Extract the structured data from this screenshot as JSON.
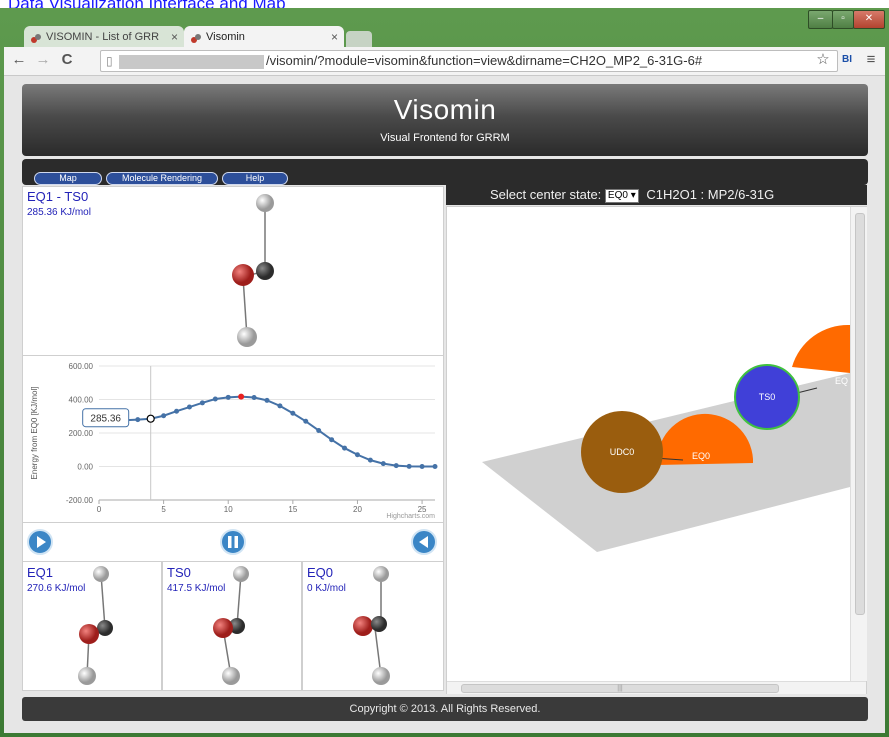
{
  "top_link": "Data Visualization Interface and Map",
  "window": {
    "tabs": [
      {
        "label": "VISOMIN - List of GRR"
      },
      {
        "label": "Visomin"
      }
    ],
    "url_prefix": "",
    "url": "/visomin/?module=visomin&function=view&dirname=CH2O_MP2_6-31G-6#",
    "bi_label": "BI"
  },
  "header": {
    "title": "Visomin",
    "subtitle": "Visual Frontend for GRRM"
  },
  "menu": [
    "Map",
    "Molecule Rendering",
    "Help"
  ],
  "top_molecule": {
    "title": "EQ1 - TS0",
    "energy": "285.36 KJ/mol"
  },
  "chart_data": {
    "type": "line",
    "ylabel": "Energy from EQ0 [KJ/mol]",
    "xlim": [
      0,
      26
    ],
    "ylim": [
      -200,
      600
    ],
    "xticks": [
      "0",
      "5",
      "10",
      "15",
      "20",
      "25"
    ],
    "yticks": [
      "600.00",
      "400.00",
      "200.00",
      "0.00",
      "-200.00"
    ],
    "credit": "Highcharts.com",
    "tooltip": "285.36",
    "highlight_index": 4,
    "peak_index": 11,
    "x": [
      0,
      1,
      2,
      3,
      4,
      5,
      6,
      7,
      8,
      9,
      10,
      11,
      12,
      13,
      14,
      15,
      16,
      17,
      18,
      19,
      20,
      21,
      22,
      23,
      24,
      25,
      26
    ],
    "values": [
      270.6,
      272,
      276,
      280,
      285.36,
      303,
      330,
      355,
      380,
      403,
      413,
      417.5,
      412,
      395,
      362,
      318,
      270,
      215,
      160,
      110,
      70,
      38,
      17,
      5,
      1,
      0,
      0
    ]
  },
  "controls": {
    "play": "play",
    "pause": "pause",
    "back": "back"
  },
  "states": [
    {
      "name": "EQ1",
      "energy": "270.6 KJ/mol"
    },
    {
      "name": "TS0",
      "energy": "417.5 KJ/mol"
    },
    {
      "name": "EQ0",
      "energy": "0 KJ/mol"
    }
  ],
  "map": {
    "select_label": "Select center state:",
    "select_value": "EQ0",
    "system": "C1H2O1 : MP2/6-31G",
    "nodes": [
      {
        "label": "UDC0",
        "color": "#9a5d0e"
      },
      {
        "label": "EQ0",
        "color": "#ff6a00"
      },
      {
        "label": "TS0",
        "color": "#4040d8"
      },
      {
        "label": "EQ",
        "color": "#ff6a00"
      }
    ],
    "scroll_thumb": "|||"
  },
  "footer": "Copyright © 2013. All Rights Reserved."
}
